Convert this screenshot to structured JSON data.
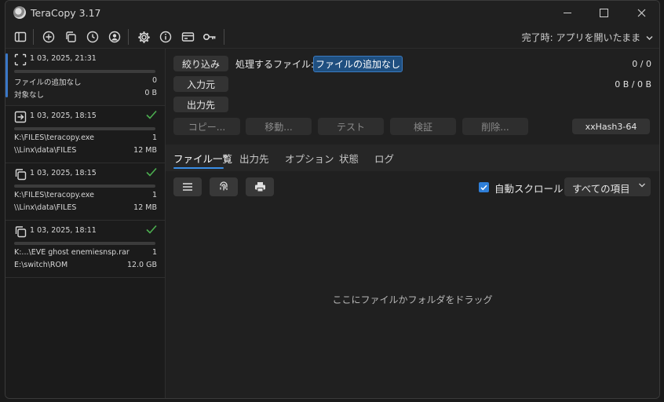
{
  "window": {
    "title": "TeraCopy 3.17"
  },
  "toolbar": {
    "icons": [
      "panel-icon",
      "add-icon",
      "copy-icon",
      "history-icon",
      "user-icon",
      "gear-icon",
      "info-icon",
      "card-icon",
      "key-icon"
    ],
    "completion_label": "完了時: アプリを開いたまま"
  },
  "jobs": [
    {
      "icon": "scan-icon",
      "date": "1 03, 2025, 21:31",
      "active": true,
      "done": false,
      "line1_left": "ファイルの追加なし",
      "line1_right": "0",
      "line2_left": "対象なし",
      "line2_right": "0 B"
    },
    {
      "icon": "move-icon",
      "date": "1 03, 2025, 18:15",
      "done": true,
      "line1_left": "K:\\FILES\\teracopy.exe",
      "line1_right": "1",
      "line2_left": "\\\\Linx\\data\\FILES",
      "line2_right": "12 MB"
    },
    {
      "icon": "copy-icon",
      "date": "1 03, 2025, 18:15",
      "done": true,
      "line1_left": "K:\\FILES\\teracopy.exe",
      "line1_right": "1",
      "line2_left": "\\\\Linx\\data\\FILES",
      "line2_right": "12 MB"
    },
    {
      "icon": "copy-icon",
      "date": "1 03, 2025, 18:11",
      "done": true,
      "line1_left": "K:...\\EVE ghost enemiesnsp.rar",
      "line1_right": "1",
      "line2_left": "E:\\switch\\ROM",
      "line2_right": "12.0 GB"
    }
  ],
  "main": {
    "filter_button": "絞り込み",
    "files_to_process_label": "処理するファイル:",
    "files_value": "ファイルの追加なし",
    "count": "0 / 0",
    "source_button": "入力元",
    "size": "0 B / 0 B",
    "target_button": "出力先",
    "actions": {
      "copy": "コピー...",
      "move": "移動...",
      "test": "テスト",
      "verify": "検証",
      "delete": "削除..."
    },
    "hash": "xxHash3-64"
  },
  "tabs": [
    "ファイル一覧",
    "出力先",
    "オプション",
    "状態",
    "ログ"
  ],
  "list_toolbar": {
    "buttons": [
      "menu-icon",
      "fingerprint-icon",
      "print-icon"
    ],
    "autoscroll_label": "自動スクロール",
    "autoscroll_checked": true,
    "filter_select": "すべての項目"
  },
  "drop_hint": "ここにファイルかフォルダをドラッグ",
  "colors": {
    "accent": "#3a8ee6",
    "pill": "#1f4f80",
    "check": "#4caf50"
  }
}
